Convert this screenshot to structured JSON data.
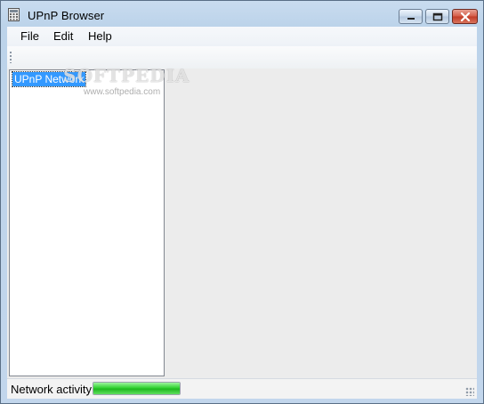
{
  "window": {
    "title": "UPnP Browser"
  },
  "menu": [
    "File",
    "Edit",
    "Help"
  ],
  "tree": {
    "root_label": "UPnP Network"
  },
  "watermark": {
    "text": "SOFTPEDIA",
    "url": "www.softpedia.com"
  },
  "status": {
    "label": "Network activity",
    "progress": 1.0,
    "progress_color": "#32d232"
  },
  "colors": {
    "selection": "#3399ff",
    "titlebar": "#bcd3ea",
    "close_button": "#c13a26"
  }
}
